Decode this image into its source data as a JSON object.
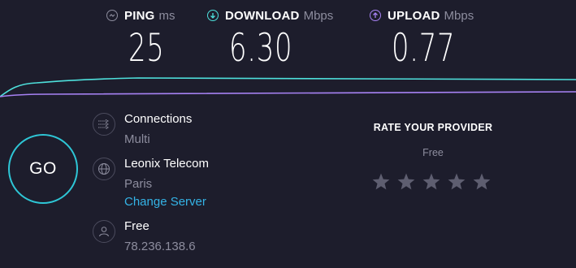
{
  "metrics": {
    "ping": {
      "label": "PING",
      "unit": "ms",
      "value": "25",
      "icon": "ping-icon",
      "color": "#8d8d9e"
    },
    "download": {
      "label": "DOWNLOAD",
      "unit": "Mbps",
      "value": "6.30",
      "icon": "download-arrow-icon",
      "color": "#4ee0dc"
    },
    "upload": {
      "label": "UPLOAD",
      "unit": "Mbps",
      "value": "0.77",
      "icon": "upload-arrow-icon",
      "color": "#a782f4"
    }
  },
  "go_label": "GO",
  "connections": {
    "title": "Connections",
    "value": "Multi",
    "icon": "connections-icon"
  },
  "server": {
    "name": "Leonix Telecom",
    "location": "Paris",
    "change_label": "Change Server",
    "icon": "globe-icon"
  },
  "user": {
    "isp": "Free",
    "ip": "78.236.138.6",
    "icon": "user-icon"
  },
  "rating": {
    "title": "RATE YOUR PROVIDER",
    "provider": "Free",
    "stars_total": 5,
    "stars_selected": 0
  },
  "colors": {
    "background": "#1d1d2c",
    "go_ring": "#2ec6d6",
    "link": "#34b3e6",
    "muted_text": "#8d8d9e",
    "star": "#5e5e70",
    "download_line": "#4ee0dc",
    "upload_line": "#a782f4"
  }
}
